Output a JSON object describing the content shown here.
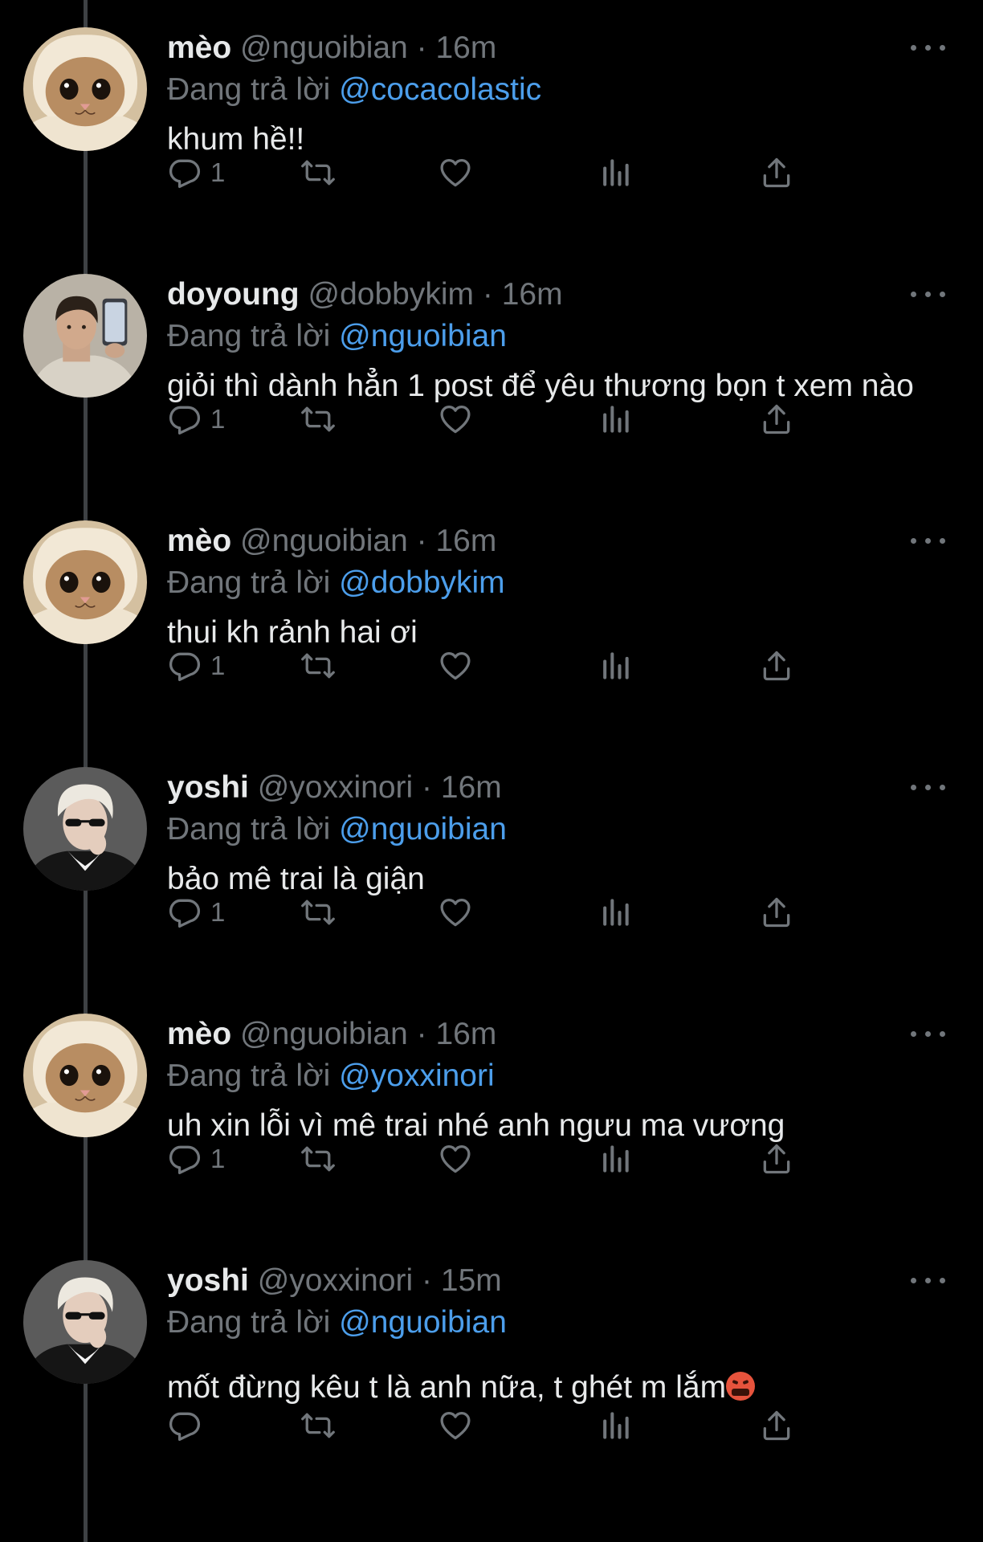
{
  "tweets": [
    {
      "name": "mèo",
      "handle": "@nguoibian",
      "dot": "·",
      "time": "16m",
      "reply_prefix": "Đang trả lời",
      "reply_to": "@cocacolastic",
      "text": "khum hề!!",
      "reply_count": "1",
      "avatar": "cat",
      "has_emoji": false
    },
    {
      "name": "doyoung",
      "handle": "@dobbykim",
      "dot": "·",
      "time": "16m",
      "reply_prefix": "Đang trả lời",
      "reply_to": "@nguoibian",
      "text": "giỏi thì dành hẳn 1 post để yêu thương bọn t xem nào",
      "reply_count": "1",
      "avatar": "person-selfie",
      "has_emoji": false
    },
    {
      "name": "mèo",
      "handle": "@nguoibian",
      "dot": "·",
      "time": "16m",
      "reply_prefix": "Đang trả lời",
      "reply_to": "@dobbykim",
      "text": "thui kh rảnh hai ơi",
      "reply_count": "1",
      "avatar": "cat",
      "has_emoji": false
    },
    {
      "name": "yoshi",
      "handle": "@yoxxinori",
      "dot": "·",
      "time": "16m",
      "reply_prefix": "Đang trả lời",
      "reply_to": "@nguoibian",
      "text": "bảo mê trai là giận",
      "reply_count": "1",
      "avatar": "person-glasses",
      "has_emoji": false
    },
    {
      "name": "mèo",
      "handle": "@nguoibian",
      "dot": "·",
      "time": "16m",
      "reply_prefix": "Đang trả lời",
      "reply_to": "@yoxxinori",
      "text": "uh xin lỗi vì mê trai nhé anh ngưu ma vương",
      "reply_count": "1",
      "avatar": "cat",
      "has_emoji": false
    },
    {
      "name": "yoshi",
      "handle": "@yoxxinori",
      "dot": "·",
      "time": "15m",
      "reply_prefix": "Đang trả lời",
      "reply_to": "@nguoibian",
      "text": "mốt đừng kêu t là anh nữa, t ghét m lắm",
      "reply_count": "",
      "avatar": "person-glasses",
      "has_emoji": true,
      "emoji_name": "angry-face-emoji"
    }
  ],
  "icons": {
    "reply": "reply-icon",
    "retweet": "retweet-icon",
    "like": "like-icon",
    "views": "views-icon",
    "share": "share-icon",
    "more": "more-icon"
  },
  "colors": {
    "background": "#000000",
    "text": "#e7e9ea",
    "muted": "#71767b",
    "mention": "#4c9eeb",
    "thread_line": "#3e4144"
  }
}
